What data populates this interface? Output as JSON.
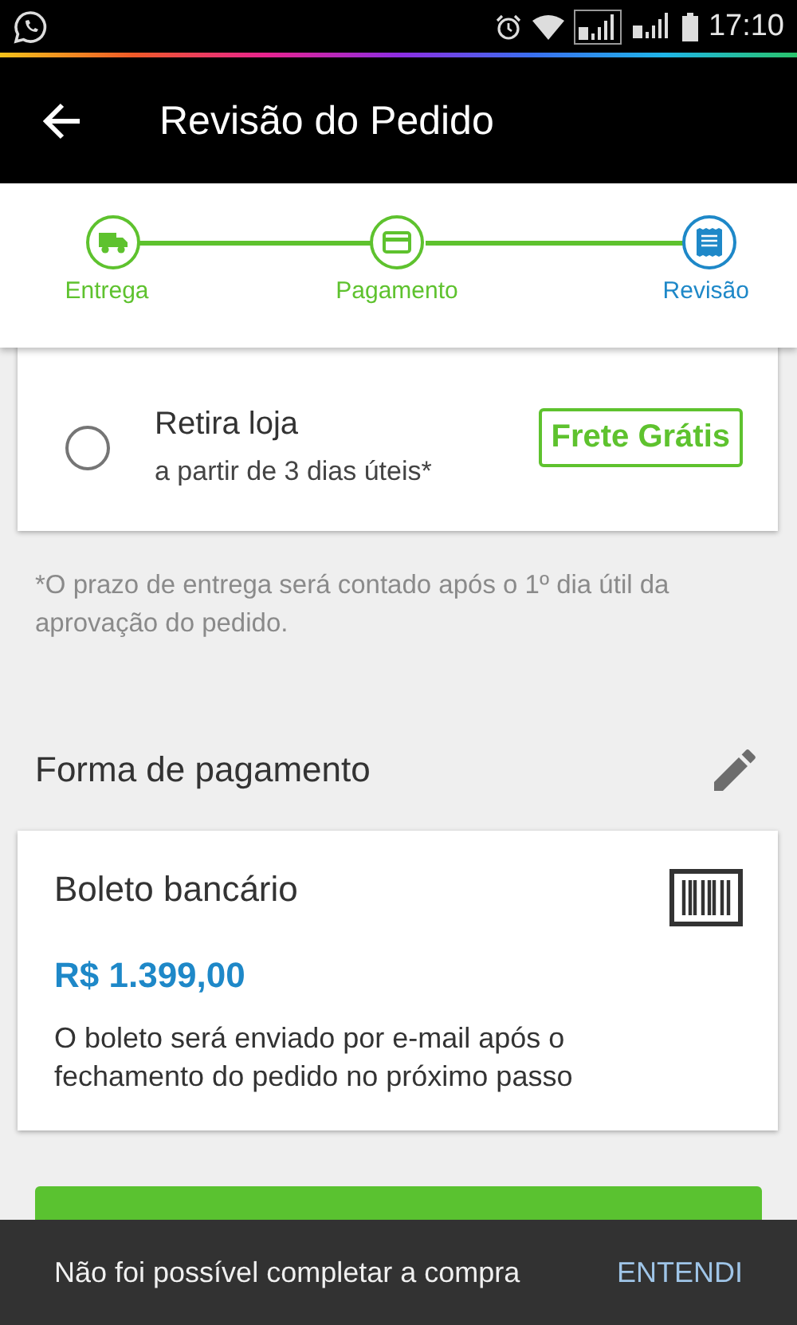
{
  "status_bar": {
    "time": "17:10"
  },
  "app_bar": {
    "title": "Revisão do Pedido"
  },
  "steps": [
    {
      "label": "Entrega",
      "kind": "truck",
      "selected": false
    },
    {
      "label": "Pagamento",
      "kind": "card",
      "selected": false
    },
    {
      "label": "Revisão",
      "kind": "receipt",
      "selected": true
    }
  ],
  "shipping_option": {
    "title": "Retira loja",
    "subtitle": "a partir de 3 dias úteis*",
    "badge": "Frete Grátis",
    "selected": false
  },
  "delivery_note": "*O prazo de entrega será contado após o 1º dia útil da aprovação do pedido.",
  "payment": {
    "heading": "Forma de pagamento",
    "method": "Boleto bancário",
    "amount": "R$ 1.399,00",
    "description": "O boleto será enviado por e-mail após o fechamento do pedido no próximo passo"
  },
  "snackbar": {
    "message": "Não foi possível completar a compra",
    "action": "ENTENDI"
  }
}
